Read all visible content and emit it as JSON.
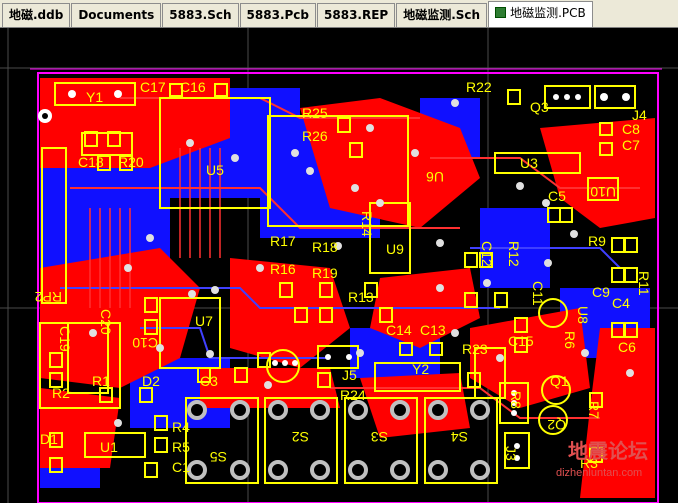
{
  "tabs": [
    {
      "label": "地磁.ddb"
    },
    {
      "label": "Documents"
    },
    {
      "label": "5883.Sch"
    },
    {
      "label": "5883.Pcb"
    },
    {
      "label": "5883.REP"
    },
    {
      "label": "地磁监测.Sch"
    },
    {
      "label": "地磁监测.PCB"
    }
  ],
  "active_tab": 6,
  "colors": {
    "top_copper": "#ff0000",
    "bottom_copper": "#1010ff",
    "silkscreen": "#ffff00",
    "board_outline": "#ff00ff",
    "pad": "#c0c0c0",
    "grid": "#4a4a4a",
    "watermark": "#e05050"
  },
  "designators": {
    "y1": "Y1",
    "c17": "C17",
    "c16": "C16",
    "r22": "R22",
    "q3": "Q3",
    "j4": "J4",
    "c8": "C8",
    "c7": "C7",
    "r25": "R25",
    "r26": "R26",
    "c18": "C18",
    "r20": "R20",
    "u5": "U5",
    "u3": "U3",
    "u6": "U6",
    "c5": "C5",
    "u10": "U10",
    "r14": "R14",
    "r17": "R17",
    "r18": "R18",
    "u9": "U9",
    "c12": "C12",
    "r12": "R12",
    "r9": "R9",
    "r11": "R11",
    "c9": "C9",
    "c4": "C4",
    "r16": "R16",
    "r19": "R19",
    "c11": "C11",
    "u8": "U8",
    "rp2": "RP2",
    "c20": "C20",
    "r13": "R13",
    "c19": "C19",
    "u7": "U7",
    "c10": "C10",
    "c14": "C14",
    "c13": "C13",
    "c15": "C15",
    "r6": "R6",
    "c6": "C6",
    "r2": "R2",
    "r1": "R1",
    "d2": "D2",
    "c3": "C3",
    "j5": "J5",
    "y2": "Y2",
    "r23": "R23",
    "q1": "Q1",
    "r24": "R24",
    "r8": "R8",
    "r7": "R7",
    "q2": "Q2",
    "r4": "R4",
    "r5": "R5",
    "u1": "U1",
    "d1": "D1",
    "c1": "C1",
    "s5": "S5",
    "s2": "S2",
    "s3": "S3",
    "s4": "S4",
    "j3": "J3",
    "r3": "R3"
  },
  "watermark": {
    "text": "地震论坛",
    "url": "dizhenluntan.com"
  }
}
